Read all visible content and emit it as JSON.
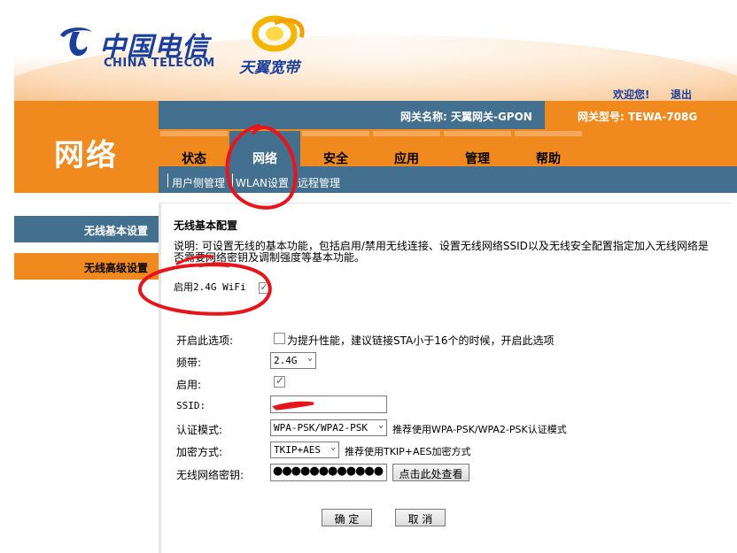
{
  "brand": {
    "telecom_cn": "中国电信",
    "telecom_en": "CHINA TELECOM",
    "broadband": "天翼宽带"
  },
  "header": {
    "welcome": "欢迎您!",
    "logout": "退出",
    "gateway_name": "网关名称: 天翼网关-GPON",
    "gateway_model": "网关型号: TEWA-708G",
    "section": "网络"
  },
  "tabs": [
    {
      "label": "状态"
    },
    {
      "label": "网络"
    },
    {
      "label": "安全"
    },
    {
      "label": "应用"
    },
    {
      "label": "管理"
    },
    {
      "label": "帮助"
    }
  ],
  "subnav": [
    {
      "label": "用户侧管理"
    },
    {
      "label": "WLAN设置"
    },
    {
      "label": "远程管理"
    }
  ],
  "menu": [
    {
      "label": "无线基本设置"
    },
    {
      "label": "无线高级设置"
    }
  ],
  "content": {
    "title": "无线基本配置",
    "description": "说明: 可设置无线的基本功能，包括启用/禁用无线连接、设置无线网络SSID以及无线安全配置指定加入无线网络是否需要网络密钥及调制强度等基本功能。",
    "enable_24g_label": "启用2.4G WiFi",
    "fields": {
      "option_label": "开启此选项:",
      "option_hint": "为提升性能，建议链接STA小于16个的时候，开启此选项",
      "band_label": "频带:",
      "band_value": "2.4G",
      "enable_label": "启用:",
      "ssid_label": "SSID:",
      "ssid_value": "",
      "auth_label": "认证模式:",
      "auth_value": "WPA-PSK/WPA2-PSK",
      "auth_hint": "推荐使用WPA-PSK/WPA2-PSK认证模式",
      "enc_label": "加密方式:",
      "enc_value": "TKIP+AES",
      "enc_hint": "推荐使用TKIP+AES加密方式",
      "key_label": "无线网络密钥:",
      "key_value": "●●●●●●●●●●●●",
      "view_button": "点击此处查看"
    },
    "ok_button": "确 定",
    "cancel_button": "取 消"
  },
  "colors": {
    "orange": "#f08a1e",
    "steel_blue": "#44708f",
    "brand_blue": "#1a3f9c",
    "annotation_red": "#e8141b"
  }
}
